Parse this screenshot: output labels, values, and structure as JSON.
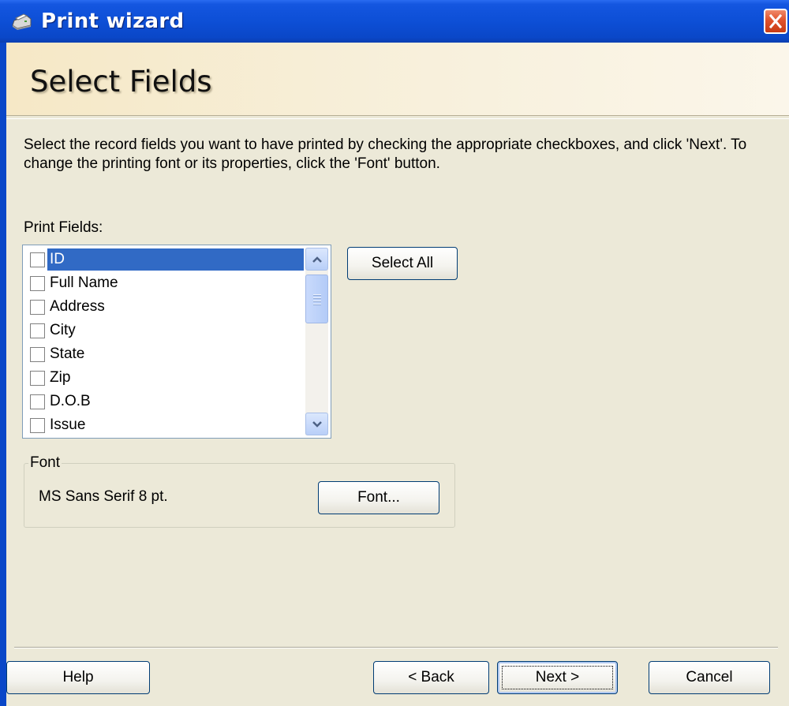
{
  "window": {
    "title": "Print wizard",
    "icon": "printer-icon"
  },
  "header": {
    "heading": "Select Fields"
  },
  "description": "Select the record fields you want to have printed by checking the appropriate checkboxes, and click 'Next'. To change the printing font or its properties, click the 'Font' button.",
  "print_fields": {
    "label": "Print Fields:",
    "items": [
      {
        "label": "ID",
        "checked": false,
        "selected": true
      },
      {
        "label": "Full Name",
        "checked": false,
        "selected": false
      },
      {
        "label": "Address",
        "checked": false,
        "selected": false
      },
      {
        "label": "City",
        "checked": false,
        "selected": false
      },
      {
        "label": "State",
        "checked": false,
        "selected": false
      },
      {
        "label": "Zip",
        "checked": false,
        "selected": false
      },
      {
        "label": "D.O.B",
        "checked": false,
        "selected": false
      },
      {
        "label": "Issue",
        "checked": false,
        "selected": false
      }
    ],
    "select_all_label": "Select All"
  },
  "font_group": {
    "label": "Font",
    "current_font": "MS Sans Serif 8 pt.",
    "font_button_label": "Font..."
  },
  "footer": {
    "help_label": "Help",
    "back_label": "< Back",
    "next_label": "Next >",
    "cancel_label": "Cancel"
  },
  "colors": {
    "titlebar": "#0a47c8",
    "selection": "#316ac5",
    "dialog_bg": "#ece9d8",
    "close_button": "#e0522c"
  }
}
